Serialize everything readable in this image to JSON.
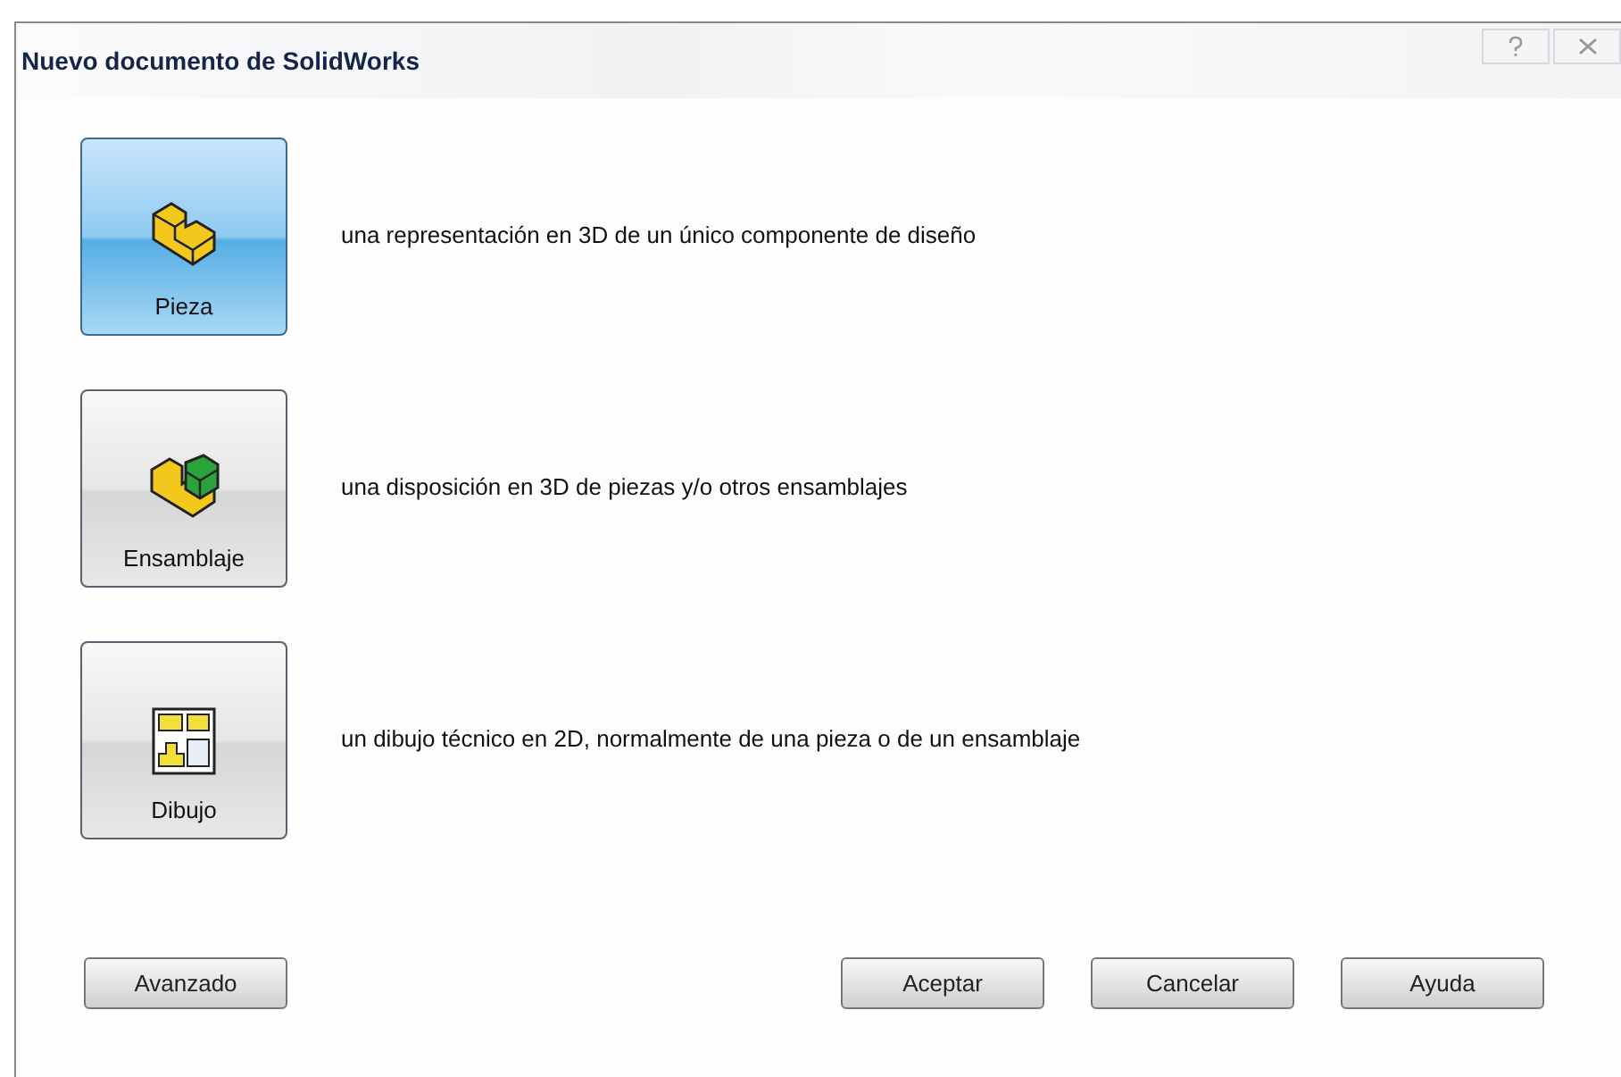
{
  "window": {
    "title": "Nuevo documento de SolidWorks",
    "controls": [
      {
        "kind": "help"
      },
      {
        "kind": "close"
      }
    ]
  },
  "document_types": [
    {
      "kind": "part",
      "label": "Pieza",
      "description": "una representación en 3D de un único componente de diseño",
      "selected": true
    },
    {
      "kind": "assembly",
      "label": "Ensamblaje",
      "description": "una disposición en 3D de piezas y/o otros ensamblajes",
      "selected": false
    },
    {
      "kind": "drawing",
      "label": "Dibujo",
      "description": "un dibujo técnico en 2D, normalmente de una pieza o de un ensamblaje",
      "selected": false
    }
  ],
  "buttons_left": [
    "Avanzado"
  ],
  "buttons_right": [
    "Aceptar",
    "Cancelar",
    "Ayuda"
  ]
}
